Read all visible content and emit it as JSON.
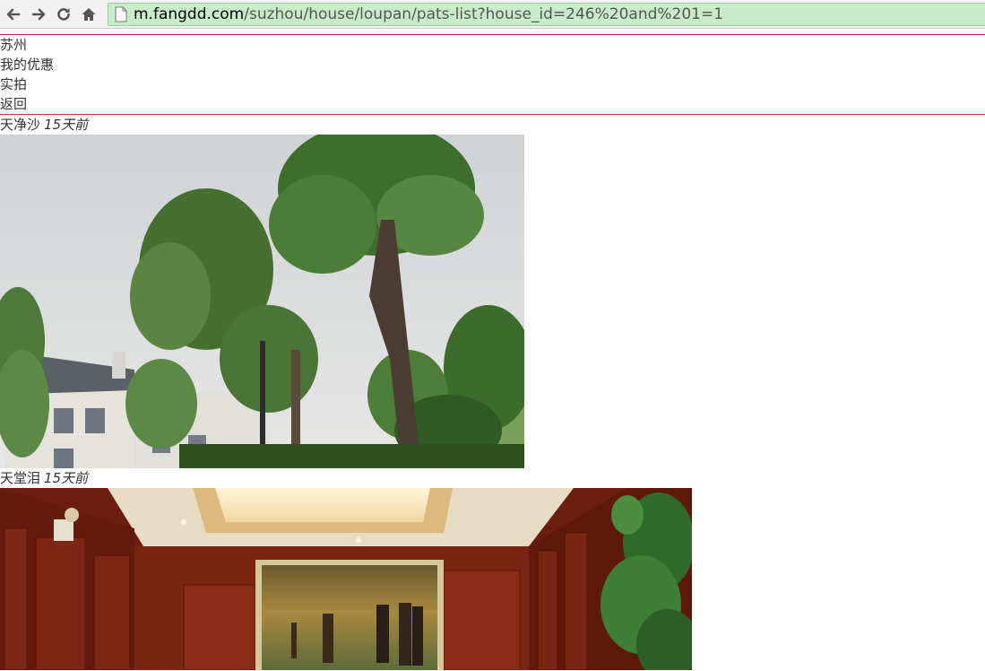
{
  "browser": {
    "url_host": "m.fangdd.com",
    "url_path": "/suzhou/house/loupan/pats-list?house_id=246%20and%201=1"
  },
  "nav": {
    "items": [
      {
        "label": "苏州"
      },
      {
        "label": "我的优惠"
      },
      {
        "label": "实拍"
      },
      {
        "label": "返回"
      }
    ]
  },
  "photos": [
    {
      "author": "天净沙",
      "time": "15天前",
      "image": "trees-villa-photo"
    },
    {
      "author": "天堂泪",
      "time": "15天前",
      "image": "wood-paneled-room-painting-photo"
    }
  ],
  "colors": {
    "divider": "#c0392b",
    "omnibox": "#c8ecc9"
  }
}
